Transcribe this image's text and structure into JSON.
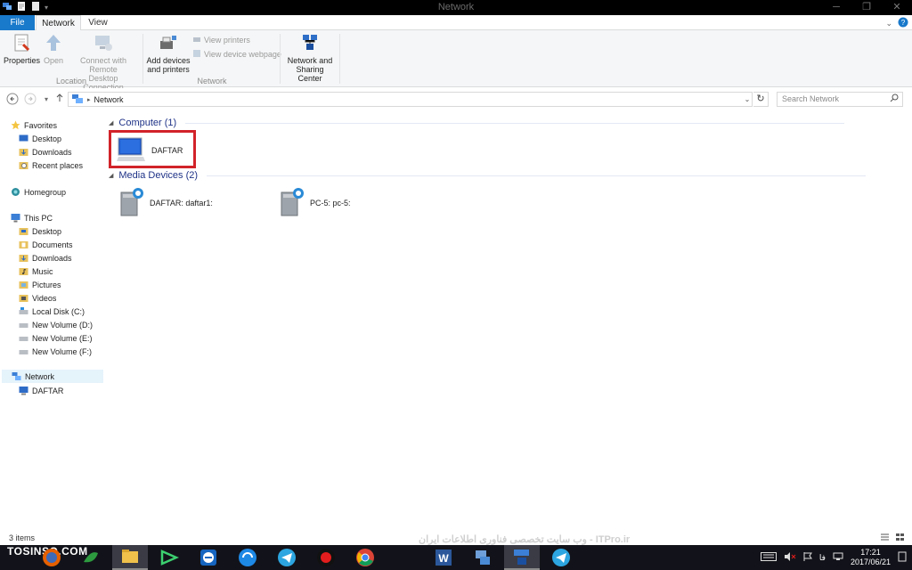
{
  "window": {
    "title": "Network"
  },
  "ribbon": {
    "tabs": {
      "file": "File",
      "network": "Network",
      "view": "View"
    },
    "properties": "Properties",
    "open": "Open",
    "connect_rdc": [
      "Connect with Remote",
      "Desktop Connection"
    ],
    "add_devices": [
      "Add devices",
      "and printers"
    ],
    "view_printers": "View printers",
    "view_device_webpage": "View device webpage",
    "network_sharing": [
      "Network and",
      "Sharing Center"
    ],
    "groups": {
      "location": "Location",
      "network": "Network"
    }
  },
  "address": {
    "path": "Network",
    "search_placeholder": "Search Network"
  },
  "navpane": {
    "favorites": "Favorites",
    "fav_items": [
      "Desktop",
      "Downloads",
      "Recent places"
    ],
    "homegroup": "Homegroup",
    "this_pc": "This PC",
    "pc_items": [
      "Desktop",
      "Documents",
      "Downloads",
      "Music",
      "Pictures",
      "Videos",
      "Local Disk (C:)",
      "New Volume (D:)",
      "New Volume (E:)",
      "New Volume (F:)"
    ],
    "network": "Network",
    "network_items": [
      "DAFTAR"
    ]
  },
  "content": {
    "computer_group": "Computer (1)",
    "computer_items": [
      "DAFTAR"
    ],
    "media_group": "Media Devices (2)",
    "media_items": [
      "DAFTAR: daftar1:",
      "PC-5: pc-5:"
    ]
  },
  "status": {
    "count": "3 items"
  },
  "taskbar": {
    "watermark_left": "TOSINSO.COM",
    "watermark_center": "وب سایت تخصصی فناوری اطلاعات ایران - ITPro.ir",
    "lang": "فا",
    "time": "17:21",
    "date": "2017/06/21"
  },
  "colors": {
    "accent": "#1979ca",
    "highlight": "#d2232a",
    "group_text": "#1e3287"
  }
}
